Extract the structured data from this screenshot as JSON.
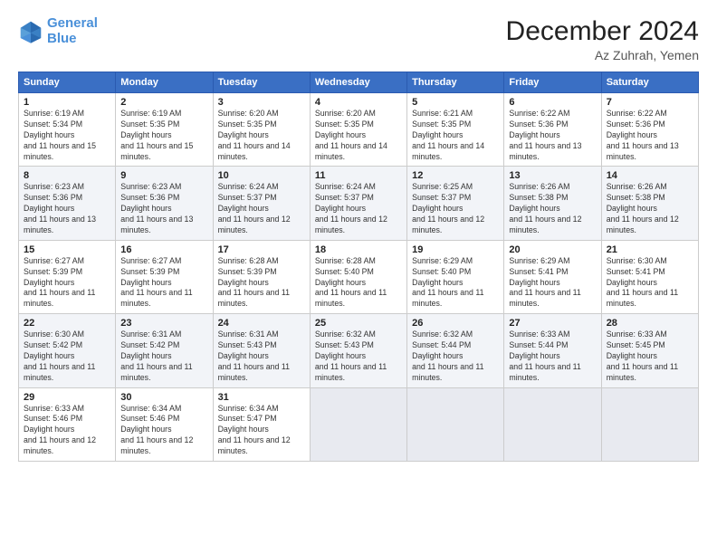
{
  "logo": {
    "line1": "General",
    "line2": "Blue"
  },
  "title": "December 2024",
  "subtitle": "Az Zuhrah, Yemen",
  "days_of_week": [
    "Sunday",
    "Monday",
    "Tuesday",
    "Wednesday",
    "Thursday",
    "Friday",
    "Saturday"
  ],
  "weeks": [
    [
      {
        "day": "1",
        "sunrise": "6:19 AM",
        "sunset": "5:34 PM",
        "daylight": "11 hours and 15 minutes."
      },
      {
        "day": "2",
        "sunrise": "6:19 AM",
        "sunset": "5:35 PM",
        "daylight": "11 hours and 15 minutes."
      },
      {
        "day": "3",
        "sunrise": "6:20 AM",
        "sunset": "5:35 PM",
        "daylight": "11 hours and 14 minutes."
      },
      {
        "day": "4",
        "sunrise": "6:20 AM",
        "sunset": "5:35 PM",
        "daylight": "11 hours and 14 minutes."
      },
      {
        "day": "5",
        "sunrise": "6:21 AM",
        "sunset": "5:35 PM",
        "daylight": "11 hours and 14 minutes."
      },
      {
        "day": "6",
        "sunrise": "6:22 AM",
        "sunset": "5:36 PM",
        "daylight": "11 hours and 13 minutes."
      },
      {
        "day": "7",
        "sunrise": "6:22 AM",
        "sunset": "5:36 PM",
        "daylight": "11 hours and 13 minutes."
      }
    ],
    [
      {
        "day": "8",
        "sunrise": "6:23 AM",
        "sunset": "5:36 PM",
        "daylight": "11 hours and 13 minutes."
      },
      {
        "day": "9",
        "sunrise": "6:23 AM",
        "sunset": "5:36 PM",
        "daylight": "11 hours and 13 minutes."
      },
      {
        "day": "10",
        "sunrise": "6:24 AM",
        "sunset": "5:37 PM",
        "daylight": "11 hours and 12 minutes."
      },
      {
        "day": "11",
        "sunrise": "6:24 AM",
        "sunset": "5:37 PM",
        "daylight": "11 hours and 12 minutes."
      },
      {
        "day": "12",
        "sunrise": "6:25 AM",
        "sunset": "5:37 PM",
        "daylight": "11 hours and 12 minutes."
      },
      {
        "day": "13",
        "sunrise": "6:26 AM",
        "sunset": "5:38 PM",
        "daylight": "11 hours and 12 minutes."
      },
      {
        "day": "14",
        "sunrise": "6:26 AM",
        "sunset": "5:38 PM",
        "daylight": "11 hours and 12 minutes."
      }
    ],
    [
      {
        "day": "15",
        "sunrise": "6:27 AM",
        "sunset": "5:39 PM",
        "daylight": "11 hours and 11 minutes."
      },
      {
        "day": "16",
        "sunrise": "6:27 AM",
        "sunset": "5:39 PM",
        "daylight": "11 hours and 11 minutes."
      },
      {
        "day": "17",
        "sunrise": "6:28 AM",
        "sunset": "5:39 PM",
        "daylight": "11 hours and 11 minutes."
      },
      {
        "day": "18",
        "sunrise": "6:28 AM",
        "sunset": "5:40 PM",
        "daylight": "11 hours and 11 minutes."
      },
      {
        "day": "19",
        "sunrise": "6:29 AM",
        "sunset": "5:40 PM",
        "daylight": "11 hours and 11 minutes."
      },
      {
        "day": "20",
        "sunrise": "6:29 AM",
        "sunset": "5:41 PM",
        "daylight": "11 hours and 11 minutes."
      },
      {
        "day": "21",
        "sunrise": "6:30 AM",
        "sunset": "5:41 PM",
        "daylight": "11 hours and 11 minutes."
      }
    ],
    [
      {
        "day": "22",
        "sunrise": "6:30 AM",
        "sunset": "5:42 PM",
        "daylight": "11 hours and 11 minutes."
      },
      {
        "day": "23",
        "sunrise": "6:31 AM",
        "sunset": "5:42 PM",
        "daylight": "11 hours and 11 minutes."
      },
      {
        "day": "24",
        "sunrise": "6:31 AM",
        "sunset": "5:43 PM",
        "daylight": "11 hours and 11 minutes."
      },
      {
        "day": "25",
        "sunrise": "6:32 AM",
        "sunset": "5:43 PM",
        "daylight": "11 hours and 11 minutes."
      },
      {
        "day": "26",
        "sunrise": "6:32 AM",
        "sunset": "5:44 PM",
        "daylight": "11 hours and 11 minutes."
      },
      {
        "day": "27",
        "sunrise": "6:33 AM",
        "sunset": "5:44 PM",
        "daylight": "11 hours and 11 minutes."
      },
      {
        "day": "28",
        "sunrise": "6:33 AM",
        "sunset": "5:45 PM",
        "daylight": "11 hours and 11 minutes."
      }
    ],
    [
      {
        "day": "29",
        "sunrise": "6:33 AM",
        "sunset": "5:46 PM",
        "daylight": "11 hours and 12 minutes."
      },
      {
        "day": "30",
        "sunrise": "6:34 AM",
        "sunset": "5:46 PM",
        "daylight": "11 hours and 12 minutes."
      },
      {
        "day": "31",
        "sunrise": "6:34 AM",
        "sunset": "5:47 PM",
        "daylight": "11 hours and 12 minutes."
      },
      null,
      null,
      null,
      null
    ]
  ]
}
